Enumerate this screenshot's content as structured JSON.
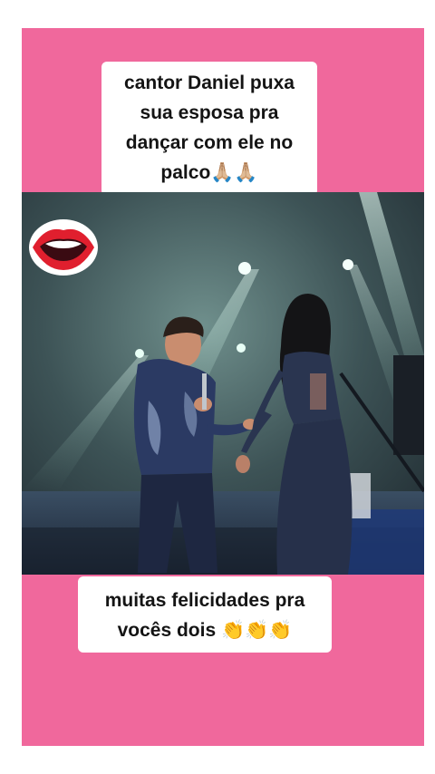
{
  "post": {
    "caption_top_lines": [
      "cantor Daniel puxa",
      "sua esposa pra",
      "dançar com ele no",
      "palco🙏🏼🙏🏼"
    ],
    "caption_bottom_lines": [
      "muitas felicidades pra",
      "vocês dois 👏👏👏"
    ]
  },
  "sticker": {
    "icon": "lips-icon"
  },
  "colors": {
    "card_background": "#f0689c",
    "caption_background": "#ffffff",
    "caption_text": "#141414"
  }
}
